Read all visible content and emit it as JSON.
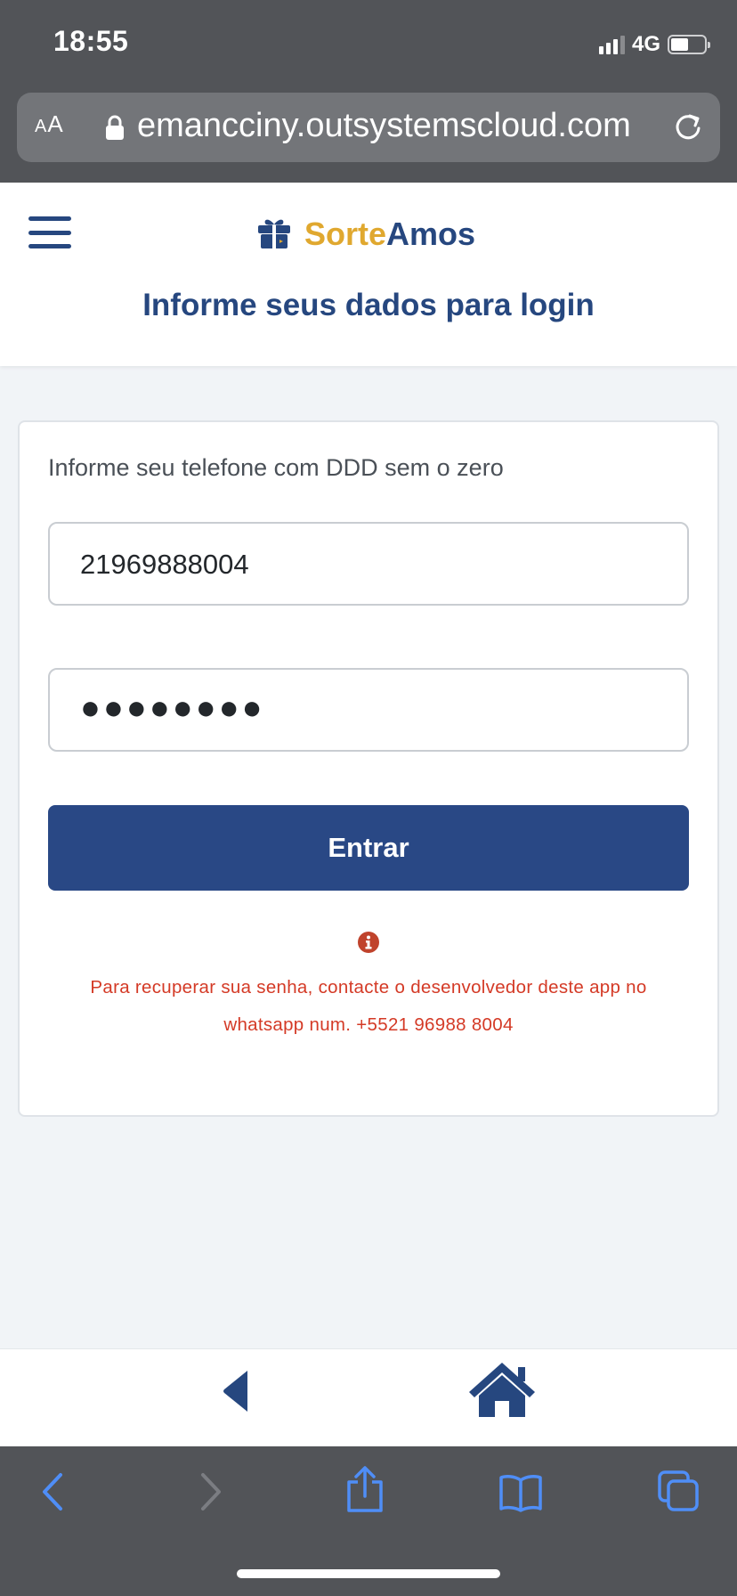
{
  "status_bar": {
    "time": "18:55",
    "network": "4G"
  },
  "browser": {
    "text_size_button": {
      "small": "A",
      "large": "A"
    },
    "url": "emancciny.outsystemscloud.com"
  },
  "header": {
    "brand_part1": "Sorte",
    "brand_part2": "Amos",
    "title": "Informe seus dados para login"
  },
  "login_form": {
    "phone_label": "Informe seu telefone com DDD sem o zero",
    "phone_value": "21969888004",
    "password_masked": "●●●●●●●●",
    "submit_label": "Entrar",
    "recovery_line1": "Para recuperar sua senha, contacte o desenvolvedor deste app no",
    "recovery_line2": "whatsapp num. +5521 96988 8004"
  },
  "icons": {
    "menu": "hamburger-menu-icon",
    "brand": "gift-icon",
    "info": "info-circle-icon",
    "nav_back": "back-triangle-icon",
    "nav_home": "house-icon",
    "safari": [
      "chevron-left-icon",
      "chevron-right-icon",
      "share-icon",
      "bookmarks-icon",
      "tabs-icon"
    ]
  },
  "colors": {
    "brand_primary": "#26477f",
    "brand_accent": "#e0a82f",
    "button": "#294885",
    "warning": "#d43a26",
    "safari_chrome": "#525458",
    "safari_tint": "#4f8ef7"
  }
}
